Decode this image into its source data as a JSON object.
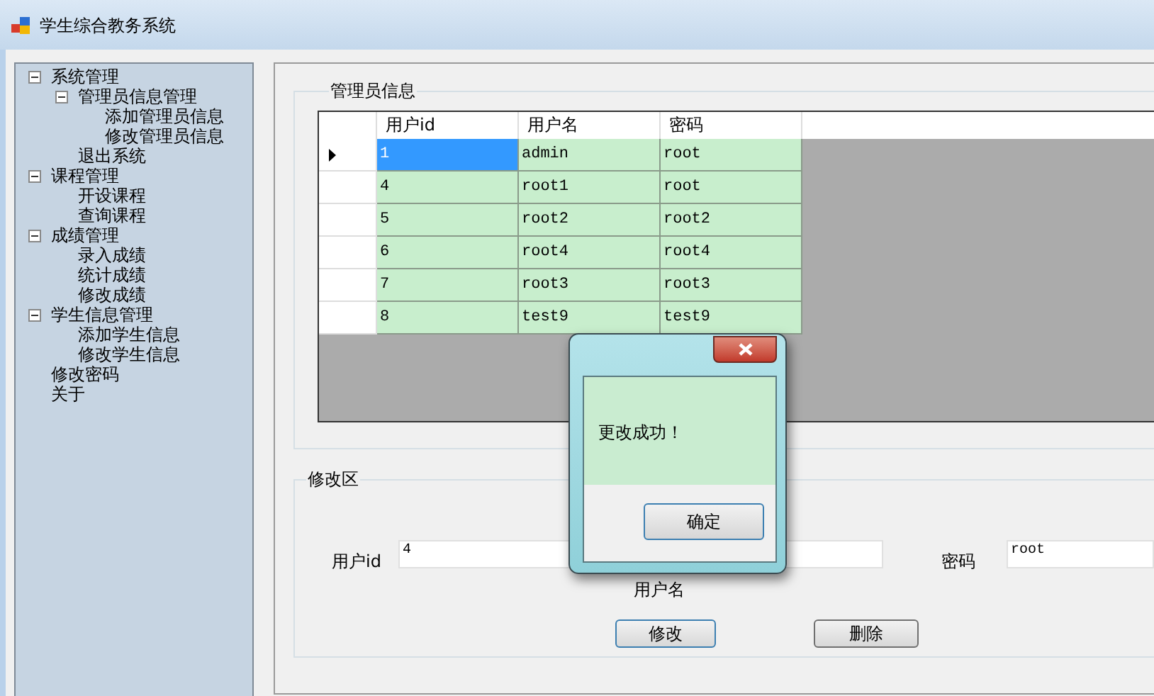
{
  "window": {
    "title": "学生综合教务系统"
  },
  "tree": [
    {
      "label": "系统管理",
      "expanded": true,
      "children": [
        {
          "label": "管理员信息管理",
          "expanded": true,
          "children": [
            {
              "label": "添加管理员信息"
            },
            {
              "label": "修改管理员信息"
            }
          ]
        },
        {
          "label": "退出系统"
        }
      ]
    },
    {
      "label": "课程管理",
      "expanded": true,
      "children": [
        {
          "label": "开设课程"
        },
        {
          "label": "查询课程"
        }
      ]
    },
    {
      "label": "成绩管理",
      "expanded": true,
      "children": [
        {
          "label": "录入成绩"
        },
        {
          "label": "统计成绩"
        },
        {
          "label": "修改成绩"
        }
      ]
    },
    {
      "label": "学生信息管理",
      "expanded": true,
      "children": [
        {
          "label": "添加学生信息"
        },
        {
          "label": "修改学生信息"
        }
      ]
    },
    {
      "label": "修改密码"
    },
    {
      "label": "关于"
    }
  ],
  "admin_group": {
    "title": "管理员信息",
    "table": {
      "columns": [
        "用户id",
        "用户名",
        "密码"
      ],
      "rows": [
        {
          "cells": [
            "1",
            "admin",
            "root"
          ],
          "selected": true
        },
        {
          "cells": [
            "4",
            "root1",
            "root"
          ],
          "selected": false
        },
        {
          "cells": [
            "5",
            "root2",
            "root2"
          ],
          "selected": false
        },
        {
          "cells": [
            "6",
            "root4",
            "root4"
          ],
          "selected": false
        },
        {
          "cells": [
            "7",
            "root3",
            "root3"
          ],
          "selected": false
        },
        {
          "cells": [
            "8",
            "test9",
            "test9"
          ],
          "selected": false
        }
      ]
    }
  },
  "edit_group": {
    "title": "修改区",
    "fields": [
      {
        "label": "用户id",
        "value": "4"
      },
      {
        "label": "用户名"
      },
      {
        "label": "密码",
        "value": "root"
      }
    ],
    "buttons": [
      "修改",
      "删除"
    ]
  },
  "dialog": {
    "message": "更改成功！",
    "button": "确定"
  }
}
